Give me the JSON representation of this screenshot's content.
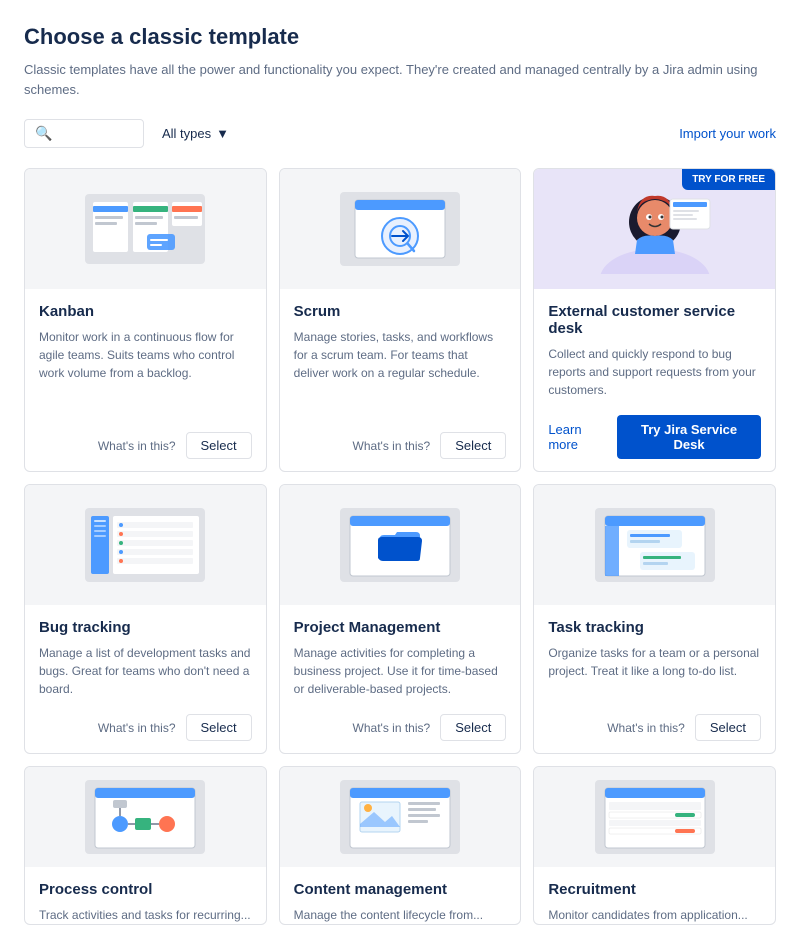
{
  "page": {
    "title": "Choose a classic template",
    "subtitle": "Classic templates have all the power and functionality you expect. They're created and managed centrally by a Jira admin using schemes.",
    "import_link": "Import your work",
    "search_placeholder": "",
    "filter_label": "All types",
    "try_badge": "TRY FOR FREE",
    "buttons": {
      "select": "Select",
      "whats_this": "What's in this?",
      "learn_more": "Learn more",
      "try_jira": "Try Jira Service Desk"
    }
  },
  "cards": [
    {
      "id": "kanban",
      "title": "Kanban",
      "description": "Monitor work in a continuous flow for agile teams. Suits teams who control work volume from a backlog.",
      "has_whats_this": true,
      "has_select": true,
      "has_try_badge": false,
      "has_learn_more": false,
      "bg": "light"
    },
    {
      "id": "scrum",
      "title": "Scrum",
      "description": "Manage stories, tasks, and workflows for a scrum team. For teams that deliver work on a regular schedule.",
      "has_whats_this": true,
      "has_select": true,
      "has_try_badge": false,
      "has_learn_more": false,
      "bg": "light"
    },
    {
      "id": "service-desk",
      "title": "External customer service desk",
      "description": "Collect and quickly respond to bug reports and support requests from your customers.",
      "has_whats_this": false,
      "has_select": false,
      "has_try_badge": true,
      "has_learn_more": true,
      "bg": "purple"
    },
    {
      "id": "bug-tracking",
      "title": "Bug tracking",
      "description": "Manage a list of development tasks and bugs. Great for teams who don't need a board.",
      "has_whats_this": true,
      "has_select": true,
      "has_try_badge": false,
      "has_learn_more": false,
      "bg": "light"
    },
    {
      "id": "project-management",
      "title": "Project Management",
      "description": "Manage activities for completing a business project. Use it for time-based or deliverable-based projects.",
      "has_whats_this": true,
      "has_select": true,
      "has_try_badge": false,
      "has_learn_more": false,
      "bg": "light"
    },
    {
      "id": "task-tracking",
      "title": "Task tracking",
      "description": "Organize tasks for a team or a personal project. Treat it like a long to-do list.",
      "has_whats_this": true,
      "has_select": true,
      "has_try_badge": false,
      "has_learn_more": false,
      "bg": "light"
    },
    {
      "id": "process-control",
      "title": "Process control",
      "description": "Track activities and tasks for recurring...",
      "has_whats_this": false,
      "has_select": false,
      "has_try_badge": false,
      "has_learn_more": false,
      "bg": "light",
      "partial": true
    },
    {
      "id": "content-management",
      "title": "Content management",
      "description": "Manage the content lifecycle from...",
      "has_whats_this": false,
      "has_select": false,
      "has_try_badge": false,
      "has_learn_more": false,
      "bg": "light",
      "partial": true
    },
    {
      "id": "recruitment",
      "title": "Recruitment",
      "description": "Monitor candidates from application...",
      "has_whats_this": false,
      "has_select": false,
      "has_try_badge": false,
      "has_learn_more": false,
      "bg": "light",
      "partial": true
    }
  ]
}
